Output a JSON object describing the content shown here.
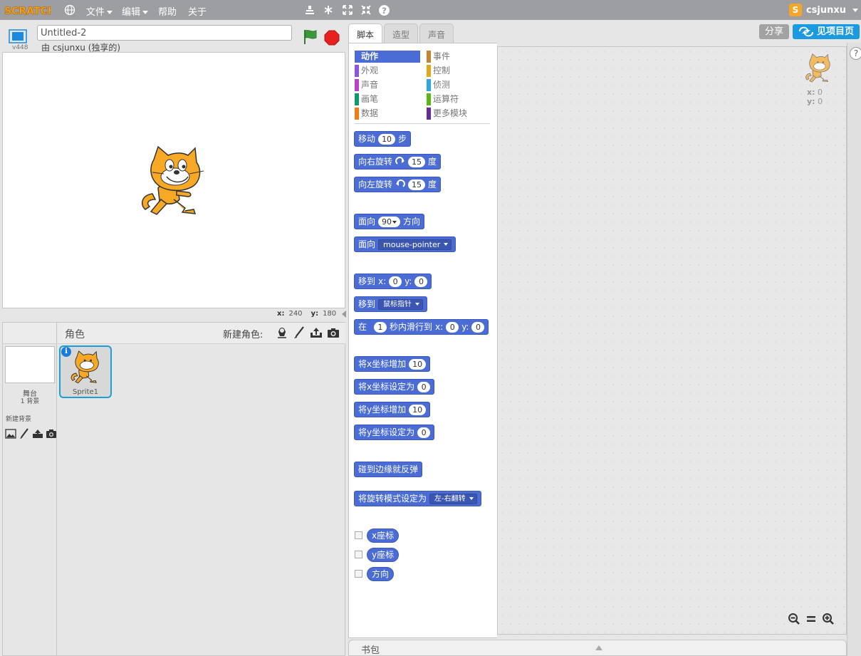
{
  "menu": {
    "logo_text": "SCRATCH",
    "file": "文件",
    "edit": "编辑",
    "help": "帮助",
    "about": "关于",
    "username": "csjunxu",
    "user_badge": "S"
  },
  "stage_header": {
    "version": "v448",
    "project_title": "Untitled-2",
    "owner": "由 csjunxu (独享的)"
  },
  "stage": {
    "coords": {
      "x_label": "x:",
      "x_value": "240",
      "y_label": "y:",
      "y_value": "180"
    }
  },
  "sprites": {
    "title": "角色",
    "new_sprite_label": "新建角色:",
    "stage_label": "舞台",
    "stage_backdrops": "1 背景",
    "new_backdrop_label": "新建背景",
    "items": [
      {
        "name": "Sprite1"
      }
    ]
  },
  "tabs": [
    "脚本",
    "造型",
    "声音"
  ],
  "actions": {
    "share": "分享",
    "see_project_page": "见项目页"
  },
  "categories": [
    {
      "label": "动作",
      "color": "#4a6cd4",
      "selected": true
    },
    {
      "label": "外观",
      "color": "#8a55d7"
    },
    {
      "label": "声音",
      "color": "#bb42c3"
    },
    {
      "label": "画笔",
      "color": "#0e9a6c"
    },
    {
      "label": "数据",
      "color": "#ee7d16"
    },
    {
      "label": "事件",
      "color": "#c88330"
    },
    {
      "label": "控制",
      "color": "#e1a91a"
    },
    {
      "label": "侦测",
      "color": "#2ca5e2"
    },
    {
      "label": "运算符",
      "color": "#5cb712"
    },
    {
      "label": "更多模块",
      "color": "#632d99"
    }
  ],
  "blocks": {
    "move": {
      "a": "移动",
      "v": "10",
      "b": "步"
    },
    "turn_right": {
      "a": "向右旋转",
      "v": "15",
      "b": "度"
    },
    "turn_left": {
      "a": "向左旋转",
      "v": "15",
      "b": "度"
    },
    "point_dir": {
      "a": "面向",
      "v": "90",
      "b": "方向"
    },
    "point_towards": {
      "a": "面向",
      "v": "mouse-pointer"
    },
    "goto_xy": {
      "a": "移到",
      "xl": "x:",
      "xv": "0",
      "yl": "y:",
      "yv": "0"
    },
    "goto": {
      "a": "移到",
      "v": "鼠标指针"
    },
    "glide": {
      "a": "在",
      "v": "1",
      "b": "秒内滑行到",
      "xl": "x:",
      "xv": "0",
      "yl": "y:",
      "yv": "0"
    },
    "change_x": {
      "a": "将x坐标增加",
      "v": "10"
    },
    "set_x": {
      "a": "将x坐标设定为",
      "v": "0"
    },
    "change_y": {
      "a": "将y坐标增加",
      "v": "10"
    },
    "set_y": {
      "a": "将y坐标设定为",
      "v": "0"
    },
    "bounce": {
      "a": "碰到边缘就反弹"
    },
    "rotation_style": {
      "a": "将旋转模式设定为",
      "v": "左-右翻转"
    },
    "reporter_x": "x座标",
    "reporter_y": "y座标",
    "reporter_dir": "方向"
  },
  "script_area": {
    "x_label": "x:",
    "x_value": "0",
    "y_label": "y:",
    "y_value": "0"
  },
  "backpack": {
    "label": "书包"
  }
}
